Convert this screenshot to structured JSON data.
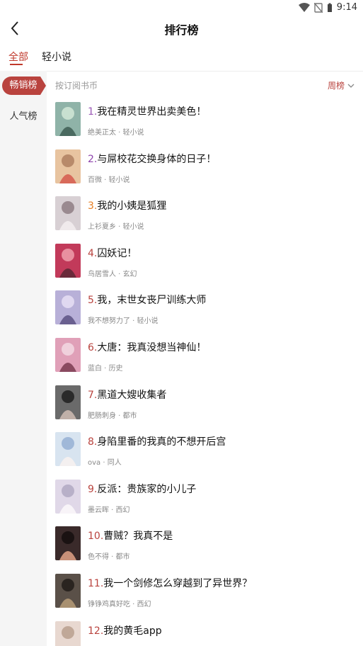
{
  "status": {
    "time": "9:14"
  },
  "header": {
    "title": "排行榜"
  },
  "tabs": [
    {
      "label": "全部",
      "active": true
    },
    {
      "label": "轻小说",
      "active": false
    }
  ],
  "sidebar": [
    {
      "label": "畅销榜",
      "active": true
    },
    {
      "label": "人气榜",
      "active": false
    }
  ],
  "content": {
    "sort_label": "按订阅书币",
    "period": "周榜"
  },
  "colors": {
    "accent": "#b9433e"
  },
  "books": [
    {
      "rank": "1.",
      "title": "我在精灵世界出卖美色！",
      "meta": "绝美正太 · 轻小说",
      "rank_color": "#9b59b6"
    },
    {
      "rank": "2.",
      "title": "与屌校花交换身体的日子！",
      "meta": "百微 · 轻小说",
      "rank_color": "#8e44ad"
    },
    {
      "rank": "3.",
      "title": "我的小姨是狐狸",
      "meta": "上衫夏乡 · 轻小说",
      "rank_color": "#e67e22"
    },
    {
      "rank": "4.",
      "title": "囚妖记！",
      "meta": "鸟居雪人 · 玄幻",
      "rank_color": "#b9433e"
    },
    {
      "rank": "5.",
      "title": "我，末世女丧尸训练大师",
      "meta": "我不想努力了 · 轻小说",
      "rank_color": "#b9433e"
    },
    {
      "rank": "6.",
      "title": "大唐：我真没想当神仙！",
      "meta": "蓝白 · 历史",
      "rank_color": "#b9433e"
    },
    {
      "rank": "7.",
      "title": "黑道大嫂收集者",
      "meta": "肥肠刺身 · 都市",
      "rank_color": "#b9433e"
    },
    {
      "rank": "8.",
      "title": "身陷里番的我真的不想开后宫",
      "meta": "ova · 同人",
      "rank_color": "#b9433e"
    },
    {
      "rank": "9.",
      "title": "反派：贵族家的小儿子",
      "meta": "墨云晖 · 西幻",
      "rank_color": "#b9433e"
    },
    {
      "rank": "10.",
      "title": "曹贼？我真不是",
      "meta": "色不得 · 都市",
      "rank_color": "#b9433e"
    },
    {
      "rank": "11.",
      "title": "我一个剑修怎么穿越到了异世界？",
      "meta": "铮铮鸡真好吃 · 西幻",
      "rank_color": "#b9433e"
    },
    {
      "rank": "12.",
      "title": "我的黄毛app",
      "meta": "",
      "rank_color": "#b9433e"
    }
  ]
}
